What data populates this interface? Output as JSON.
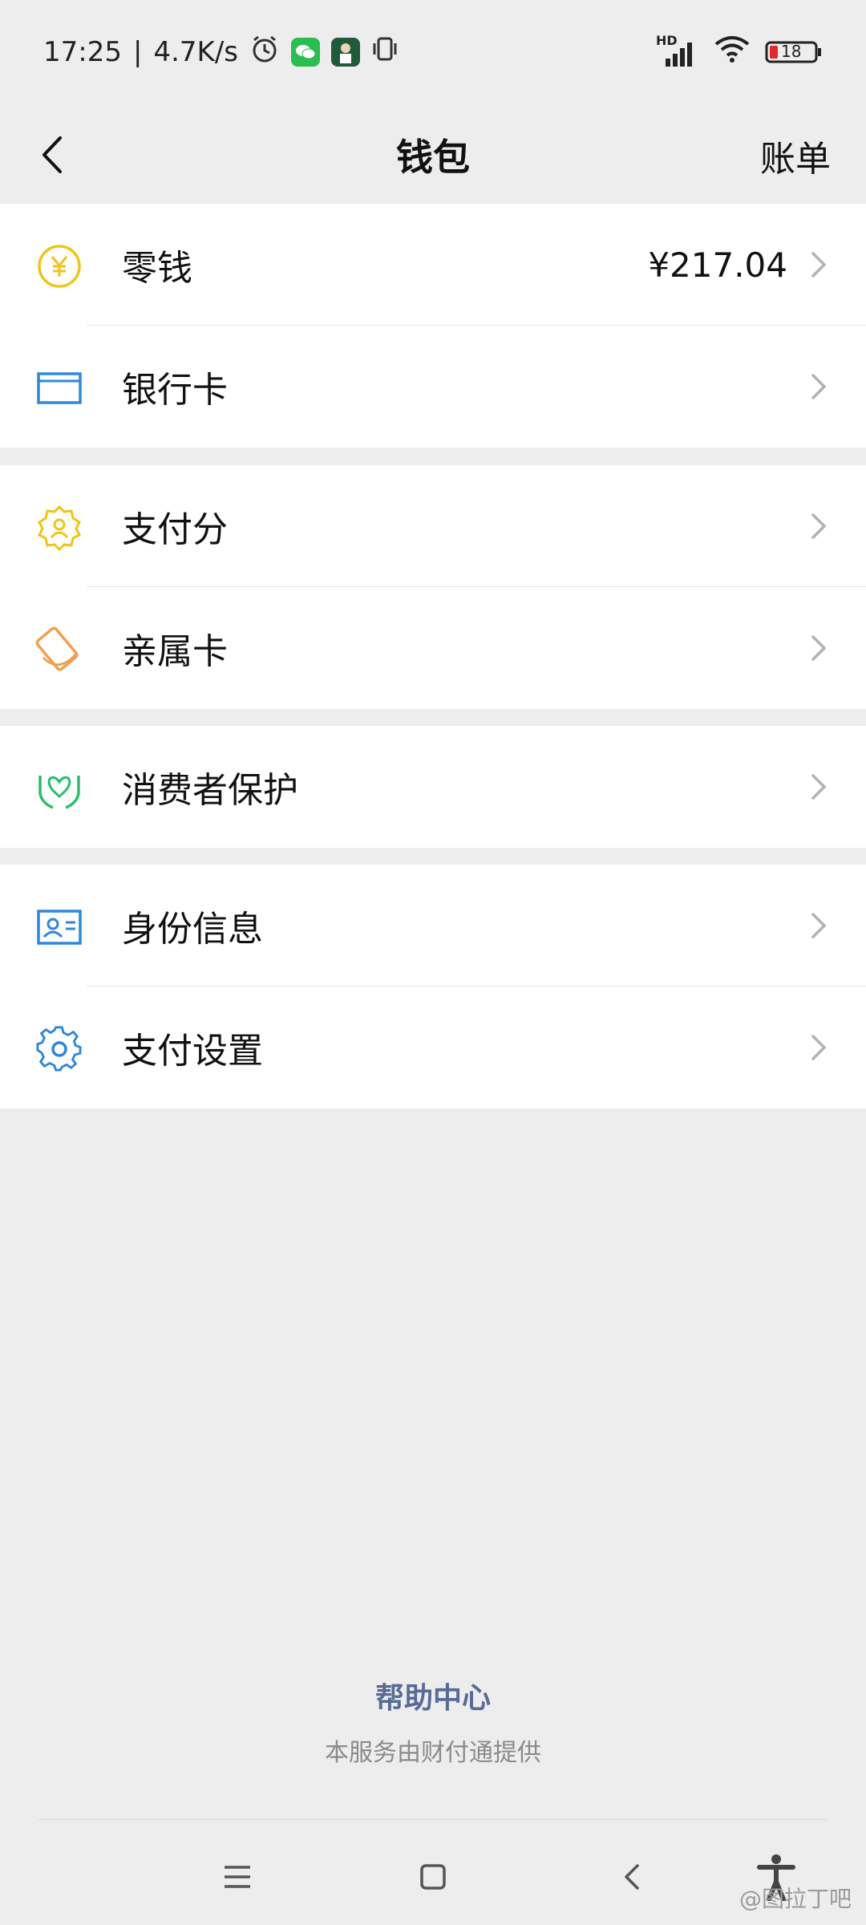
{
  "status_bar": {
    "time": "17:25",
    "net_speed": "4.7K/s",
    "signal_label": "HD",
    "battery": "18",
    "separator": "|"
  },
  "nav": {
    "title": "钱包",
    "right_action": "账单",
    "back_icon": "chevron-left-icon"
  },
  "groups": [
    {
      "items": [
        {
          "label": "零钱",
          "value": "¥217.04",
          "icon": "yuan-coin-icon",
          "icon_color": "#f0c419"
        },
        {
          "label": "银行卡",
          "value": "",
          "icon": "bank-card-icon",
          "icon_color": "#2e87d8"
        }
      ]
    },
    {
      "items": [
        {
          "label": "支付分",
          "value": "",
          "icon": "credit-score-icon",
          "icon_color": "#f0c419"
        },
        {
          "label": "亲属卡",
          "value": "",
          "icon": "family-card-icon",
          "icon_color": "#f0a050"
        }
      ]
    },
    {
      "items": [
        {
          "label": "消费者保护",
          "value": "",
          "icon": "consumer-protection-icon",
          "icon_color": "#2bbd6b"
        }
      ]
    },
    {
      "items": [
        {
          "label": "身份信息",
          "value": "",
          "icon": "id-card-icon",
          "icon_color": "#2e87d8"
        },
        {
          "label": "支付设置",
          "value": "",
          "icon": "gear-icon",
          "icon_color": "#2e87d8"
        }
      ]
    }
  ],
  "footer": {
    "help": "帮助中心",
    "provider": "本服务由财付通提供"
  },
  "watermark": "@图拉丁吧",
  "colors": {
    "link": "#576b95",
    "background": "#ededed"
  }
}
